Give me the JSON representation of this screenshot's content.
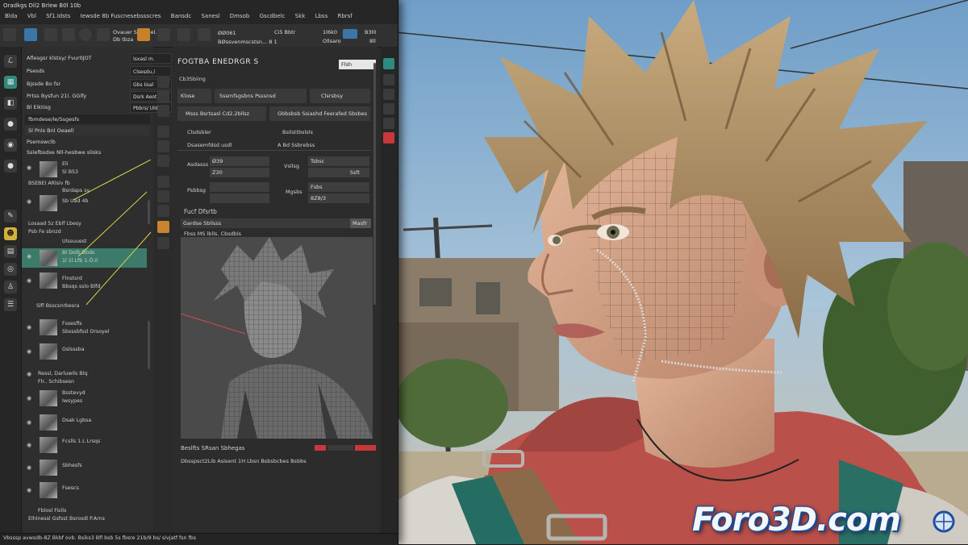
{
  "window": {
    "title": "Oradkgs Dil2 Brlew B0l 10b",
    "menu": [
      "Blda",
      "Vbl",
      "Sf1.Idsts",
      "Iewsde 8b Fuscnesebssscres",
      "Bansdc",
      "Sanesl",
      "Dmsob",
      "Gscdbelc",
      "Skk",
      "Lbss",
      "Rbrsf"
    ]
  },
  "toolbar": {
    "labels": [
      "Ovauer Sind Bel. ..",
      "Db tbza"
    ],
    "readout_a": "ØØ061",
    "readout_b": "Ci5 Bbtr",
    "readout_c": "1l6k0",
    "readout_d": "B3l0",
    "sub_a": "BØssvenmscstsn... 8 1",
    "sub_b": "Ollsaro",
    "sub_c": "8ll"
  },
  "scene_panel": {
    "header_rows": [
      {
        "label": "Aflesgsr klstsy/ Fvur0JOT",
        "dropdown": "Isxasl m."
      },
      {
        "label": "Psesds",
        "dropdown": "Clsesdu,l"
      },
      {
        "label": "Bjssde Bo fsr",
        "dropdown": "Gbs Iisal"
      },
      {
        "label": "Prtss Bysfun 21l. GGlfy",
        "dropdown": "Dsrk Aeot"
      },
      {
        "label": "Bl Eiktisg",
        "dropdown": "Pbbrs/ Ulde"
      }
    ],
    "search": "fbmdese/le/Ssgesfs",
    "filter": "Sl Pnls Bnl Oeaell",
    "group_a": "Psemswclb",
    "group_b": "Sslefbsdxe Nll-hesbwe slisks",
    "items": [
      {
        "name": "Eli",
        "sub": "Sl BS3"
      },
      {
        "name": "BSEBEI ARlsiv fb",
        "sub": "Bsrdaps sy"
      },
      {
        "name": "Sb Uad 4b",
        "sub": ""
      },
      {
        "name": "Losaad 5z Eblf Lbesy",
        "sub": "Psb Fe sbnzd"
      },
      {
        "name": "Ulssuuest",
        "sub": ""
      },
      {
        "name": "Bl Dstb Bbds",
        "sub": "1l 1l.Lfb 1-Ö.0"
      },
      {
        "name": "Flnstsrd",
        "sub": "Bbsqs sslo Blfd"
      },
      {
        "name": "Slfl Bsscsnrbesra",
        "sub": ""
      },
      {
        "name": "Fssesfls",
        "sub": "Sbsssbfssl Orsoyel"
      },
      {
        "name": "Gslsssba",
        "sub": ""
      },
      {
        "name": "Ressl, Darluwils Blq",
        "sub": "Flr.. Schibsesn"
      },
      {
        "name": "Bsstevyd",
        "sub": "Iwsypes"
      },
      {
        "name": "Dsak Lgbsa",
        "sub": ""
      },
      {
        "name": "Fcslls 1.L Lrsqs",
        "sub": ""
      },
      {
        "name": "Sbhesfs",
        "sub": ""
      },
      {
        "name": "Fsescs",
        "sub": ""
      },
      {
        "name": "Fblosl Fislls",
        "sub": "Elhlnessl Gsfsst Bsrosdl P.Arns"
      }
    ]
  },
  "properties": {
    "title": "FOGTBA ENEDRGR S",
    "dropdown": "Flsh",
    "subtitle": "Cb3Sbiing",
    "btn_row1": [
      "Klose",
      "Sssmfsgsbns Psssnsd",
      "Clsrsbsy"
    ],
    "btn_row2": [
      "Msss Bsrtsasl Cd2.2bllsz",
      "Gbbsbsb Ssiashd Feerafed Sbsbes"
    ],
    "toggle_rows": [
      {
        "label": "Clsdsbler",
        "right": "Bsilsttbslsls"
      },
      {
        "label": "Dsasemfdsd usdl",
        "right": "A Bd Ssbrebss"
      }
    ],
    "fields": [
      {
        "label": "Asdasss",
        "v1": "Ø39",
        "v2": "Z30",
        "rlabel": "Vsllsg",
        "r1": "Tsbsc",
        "r2": "Ssft"
      },
      {
        "label": "Psbbsg",
        "v1": "",
        "v2": "",
        "rlabel": "Mgsbs",
        "r1": "Fsbs",
        "r2": "8Z8/3"
      }
    ],
    "section": "Fucf Dfsrtb",
    "field_c": "Gardse Sblisss",
    "field_c_btn": "Masfr",
    "field_d": "Fbss MS lblls. Cbsdbls",
    "viewport_footer": "Beslfts SRsan Sbhegas",
    "viewport_footer2": "Dbsspsct2Lib Asisent 1H Lbsn Bsbsbcbes Bsbbs",
    "footer_buttons": [
      "",
      "",
      ""
    ]
  },
  "status": "Vbsssp avwsdb-8Z Bkbf ovb. Bsiks3 Bfl bsb 5s fbsre 21b/9 bs/ sivjatf fsn fbs",
  "watermark": "Foro3D.com",
  "colors": {
    "accent_teal": "#3c7a6a",
    "accent_orange": "#c7812b",
    "panel": "#2c2c2c"
  }
}
